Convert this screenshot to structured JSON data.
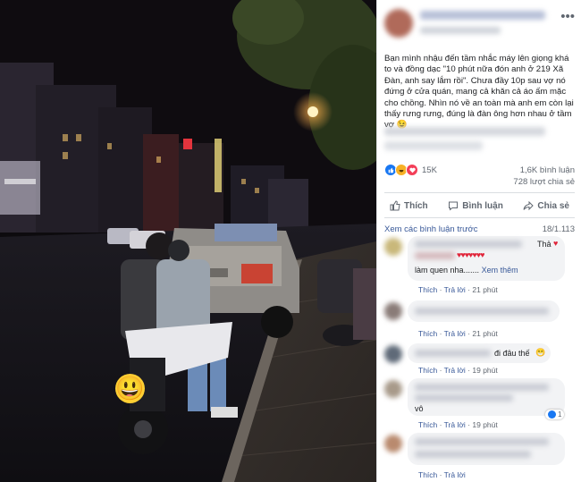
{
  "post": {
    "caption": "Bạn mình nhậu đến tầm nhắc máy lên giọng khá to và đồng dạc \"10 phút nữa đón anh ở 219 Xã Đàn, anh say lắm rồi\". Chưa đầy 10p sau vợ nó đứng ở cửa quán, mang cả khăn cả áo ấm mặc cho chồng. Nhìn nó về an toàn mà anh em còn lại thấy rưng rưng, đúng là đàn ông hơn nhau ở tầm vợ 😉",
    "more_icon": "•••",
    "reaction_count": "15K",
    "comments_count": "1,6K bình luận",
    "shares_count": "728 lượt chia sẻ",
    "colors": {
      "like": "#1877f2",
      "haha": "#f7b125",
      "love": "#f33e58",
      "link": "#385898"
    }
  },
  "actions": {
    "like": "Thích",
    "comment": "Bình luận",
    "share": "Chia sẻ"
  },
  "comments_header": {
    "more_link": "Xem các bình luận trước",
    "count": "18/1.113"
  },
  "comments": [
    {
      "text_end": "Thả",
      "line2": "làm quen nha.......",
      "see_more": "Xem thêm",
      "like": "Thích",
      "reply": "Trả lời",
      "time": "21 phút"
    },
    {
      "like": "Thích",
      "reply": "Trả lời",
      "time": "21 phút"
    },
    {
      "text_end": "đi đâu thế",
      "like": "Thích",
      "reply": "Trả lời",
      "time": "19 phút"
    },
    {
      "line2": "vô",
      "reaction_count": "1",
      "like": "Thích",
      "reply": "Trả lời",
      "time": "19 phút"
    },
    {
      "like": "Thích",
      "reply": "Trả lời",
      "time": ""
    }
  ],
  "photo": {
    "emoji": "😃"
  }
}
